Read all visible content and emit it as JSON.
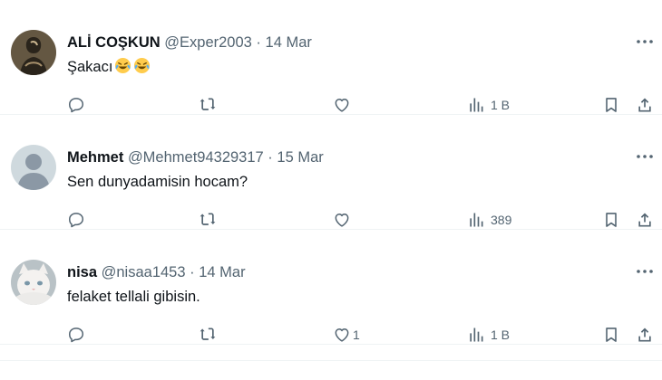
{
  "tweets": [
    {
      "display_name": "ALİ COŞKUN",
      "handle": "@Exper2003",
      "separator": "·",
      "date": "14 Mar",
      "text": "Şakacı",
      "emojis": [
        "face-with-tears-of-joy",
        "face-with-tears-of-joy"
      ],
      "avatar": "bust-statue",
      "likes": "",
      "views": "1 B"
    },
    {
      "display_name": "Mehmet",
      "handle": "@Mehmet94329317",
      "separator": "·",
      "date": "15 Mar",
      "text": "Sen dunyadamisin hocam?",
      "emojis": [],
      "avatar": "default-profile",
      "likes": "",
      "views": "389"
    },
    {
      "display_name": "nisa",
      "handle": "@nisaa1453",
      "separator": "·",
      "date": "14 Mar",
      "text": "felaket tellali gibisin.",
      "emojis": [],
      "avatar": "white-cat",
      "likes": "1",
      "views": "1 B"
    }
  ],
  "icons": {
    "reply": "reply-icon",
    "retweet": "retweet-icon",
    "like": "heart-icon",
    "views": "views-icon",
    "bookmark": "bookmark-icon",
    "share": "share-icon",
    "more": "more-icon"
  },
  "colors": {
    "text": "#0f1419",
    "muted": "#536471",
    "divider": "#eff3f4"
  }
}
